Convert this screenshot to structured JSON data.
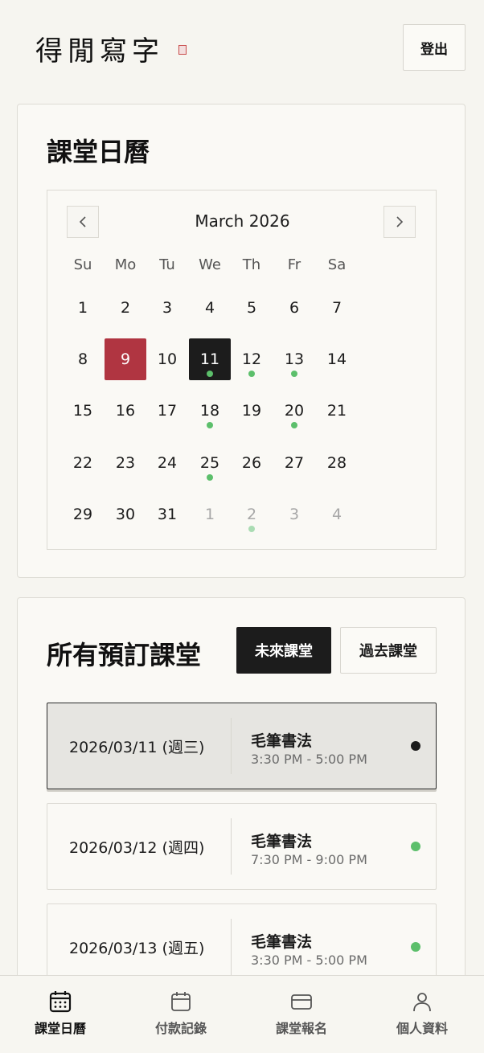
{
  "header": {
    "logo": "得閒寫字",
    "logout_label": "登出"
  },
  "calendar_card": {
    "title": "課堂日曆",
    "month_label": "March 2026",
    "weekdays": [
      "Su",
      "Mo",
      "Tu",
      "We",
      "Th",
      "Fr",
      "Sa"
    ],
    "weeks": [
      [
        "1",
        "2",
        "3",
        "4",
        "5",
        "6",
        "7"
      ],
      [
        "8",
        "9",
        "10",
        "11",
        "12",
        "13",
        "14"
      ],
      [
        "15",
        "16",
        "17",
        "18",
        "19",
        "20",
        "21"
      ],
      [
        "22",
        "23",
        "24",
        "25",
        "26",
        "27",
        "28"
      ],
      [
        "29",
        "30",
        "31",
        "1",
        "2",
        "3",
        "4"
      ]
    ]
  },
  "reservations_card": {
    "title": "所有預訂課堂",
    "filter_upcoming": "未來課堂",
    "filter_past": "過去課堂",
    "items": [
      {
        "date": "2026/03/11 (週三)",
        "course": "毛筆書法",
        "time": "3:30 PM - 5:00 PM"
      },
      {
        "date": "2026/03/12 (週四)",
        "course": "毛筆書法",
        "time": "7:30 PM - 9:00 PM"
      },
      {
        "date": "2026/03/13 (週五)",
        "course": "毛筆書法",
        "time": "3:30 PM - 5:00 PM"
      }
    ]
  },
  "bottom_nav": {
    "items": [
      {
        "label": "課堂日曆",
        "icon": "calendar-grid-icon"
      },
      {
        "label": "付款記錄",
        "icon": "calendar-icon"
      },
      {
        "label": "課堂報名",
        "icon": "credit-card-icon"
      },
      {
        "label": "個人資料",
        "icon": "user-icon"
      }
    ]
  },
  "colors": {
    "accent_today": "#b03541",
    "selected": "#1c1c1c",
    "event_dot": "#5cbf6b",
    "background": "#f6f5f0"
  }
}
